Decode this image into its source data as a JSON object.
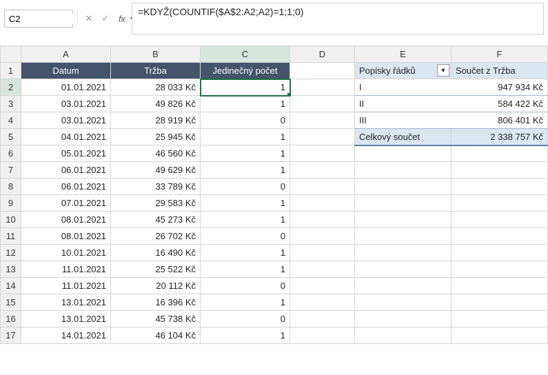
{
  "formula_bar": {
    "cell_ref": "C2",
    "formula": "=KDYŽ(COUNTIF($A$2:A2;A2)=1;1;0)"
  },
  "columns": [
    "A",
    "B",
    "C",
    "D",
    "E",
    "F"
  ],
  "active_col": "C",
  "active_row": 2,
  "headers": {
    "A": "Datum",
    "B": "Tržba",
    "C": "Jedinečný počet"
  },
  "rows": [
    {
      "n": 1
    },
    {
      "n": 2,
      "A": "01.01.2021",
      "B": "28 033 Kč",
      "C": "1"
    },
    {
      "n": 3,
      "A": "03.01.2021",
      "B": "49 826 Kč",
      "C": "1"
    },
    {
      "n": 4,
      "A": "03.01.2021",
      "B": "28 919 Kč",
      "C": "0"
    },
    {
      "n": 5,
      "A": "04.01.2021",
      "B": "25 945 Kč",
      "C": "1"
    },
    {
      "n": 6,
      "A": "05.01.2021",
      "B": "46 560 Kč",
      "C": "1"
    },
    {
      "n": 7,
      "A": "06.01.2021",
      "B": "49 629 Kč",
      "C": "1"
    },
    {
      "n": 8,
      "A": "06.01.2021",
      "B": "33 789 Kč",
      "C": "0"
    },
    {
      "n": 9,
      "A": "07.01.2021",
      "B": "29 583 Kč",
      "C": "1"
    },
    {
      "n": 10,
      "A": "08.01.2021",
      "B": "45 273 Kč",
      "C": "1"
    },
    {
      "n": 11,
      "A": "08.01.2021",
      "B": "26 702 Kč",
      "C": "0"
    },
    {
      "n": 12,
      "A": "10.01.2021",
      "B": "16 490 Kč",
      "C": "1"
    },
    {
      "n": 13,
      "A": "11.01.2021",
      "B": "25 522 Kč",
      "C": "1"
    },
    {
      "n": 14,
      "A": "11.01.2021",
      "B": "20 112 Kč",
      "C": "0"
    },
    {
      "n": 15,
      "A": "13.01.2021",
      "B": "16 396 Kč",
      "C": "1"
    },
    {
      "n": 16,
      "A": "13.01.2021",
      "B": "45 738 Kč",
      "C": "0"
    },
    {
      "n": 17,
      "A": "14.01.2021",
      "B": "46 104 Kč",
      "C": "1"
    }
  ],
  "pivot": {
    "row_label_header": "Popisky řádků",
    "value_header": "Součet z Tržba",
    "items": [
      {
        "label": "I",
        "value": "947 934 Kč"
      },
      {
        "label": "II",
        "value": "584 422 Kč"
      },
      {
        "label": "III",
        "value": "806 401 Kč"
      }
    ],
    "total_label": "Celkový součet",
    "total_value": "2 338 757 Kč"
  }
}
